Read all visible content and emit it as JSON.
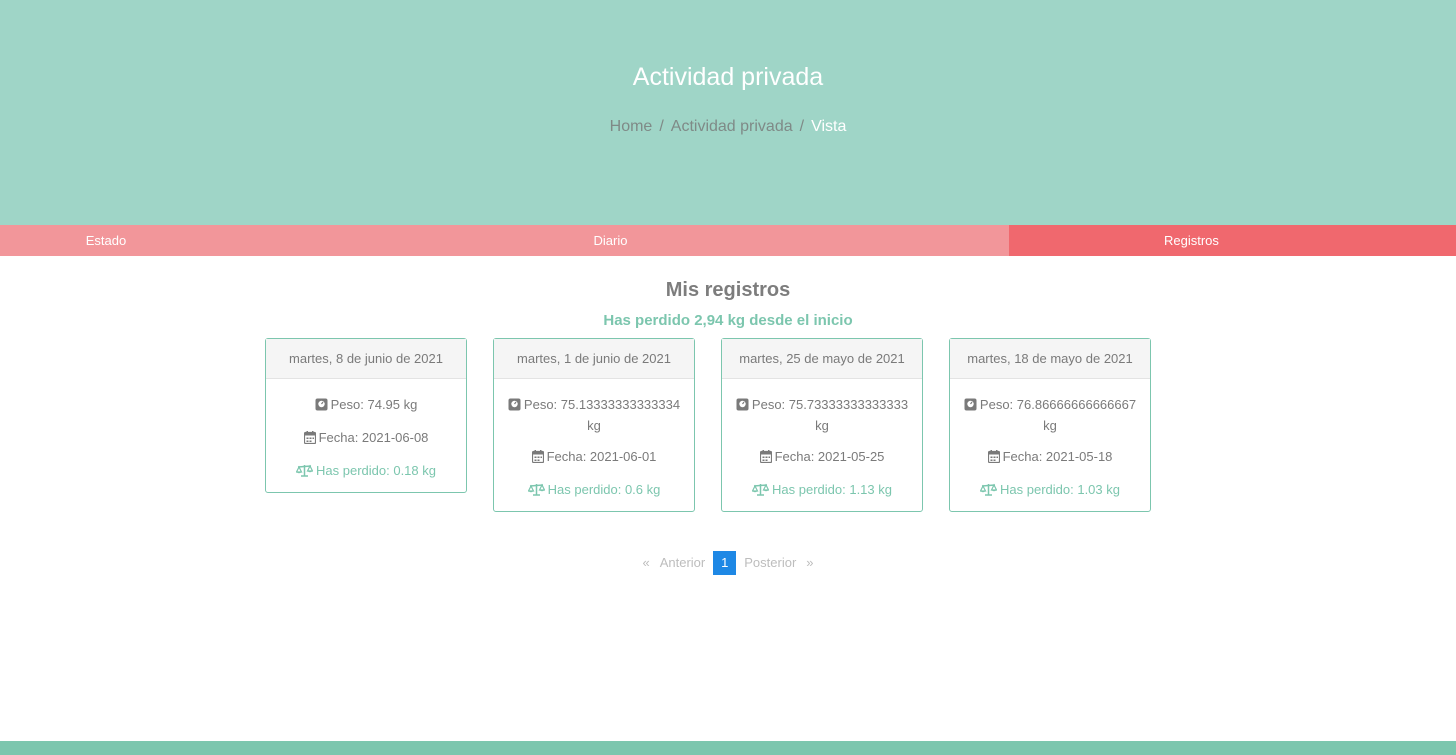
{
  "hero": {
    "title": "Actividad privada",
    "breadcrumb": {
      "home": "Home",
      "section": "Actividad privada",
      "current": "Vista",
      "separator": "/"
    }
  },
  "tabs": [
    {
      "label": "Estado"
    },
    {
      "label": "Diario"
    },
    {
      "label": "Registros",
      "active": true
    }
  ],
  "main": {
    "title": "Mis registros",
    "subtitle": "Has perdido 2,94 kg desde el inicio",
    "records": [
      {
        "date": "martes, 8 de junio de 2021",
        "peso": "Peso: 74.95 kg",
        "fecha": "Fecha: 2021-06-08",
        "perdido": "Has perdido: 0.18 kg"
      },
      {
        "date": "martes, 1 de junio de 2021",
        "peso": "Peso: 75.13333333333334 kg",
        "fecha": "Fecha: 2021-06-01",
        "perdido": "Has perdido: 0.6 kg"
      },
      {
        "date": "martes, 25 de mayo de 2021",
        "peso": "Peso: 75.73333333333333 kg",
        "fecha": "Fecha: 2021-05-25",
        "perdido": "Has perdido: 1.13 kg"
      },
      {
        "date": "martes, 18 de mayo de 2021",
        "peso": "Peso: 76.86666666666667 kg",
        "fecha": "Fecha: 2021-05-18",
        "perdido": "Has perdido: 1.03 kg"
      }
    ]
  },
  "pagination": {
    "prev_symbol": "«",
    "prev_label": "Anterior",
    "current_page": "1",
    "next_label": "Posterior",
    "next_symbol": "»"
  },
  "icons": {
    "weight": "weight-scale-icon",
    "calendar": "calendar-icon",
    "balance": "balance-scale-icon"
  },
  "colors": {
    "hero_bg": "#9fd5c7",
    "tab_bg": "#f2969a",
    "tab_active_bg": "#f0686e",
    "accent_green": "#7cc6ae",
    "page_active": "#1e88e5"
  }
}
